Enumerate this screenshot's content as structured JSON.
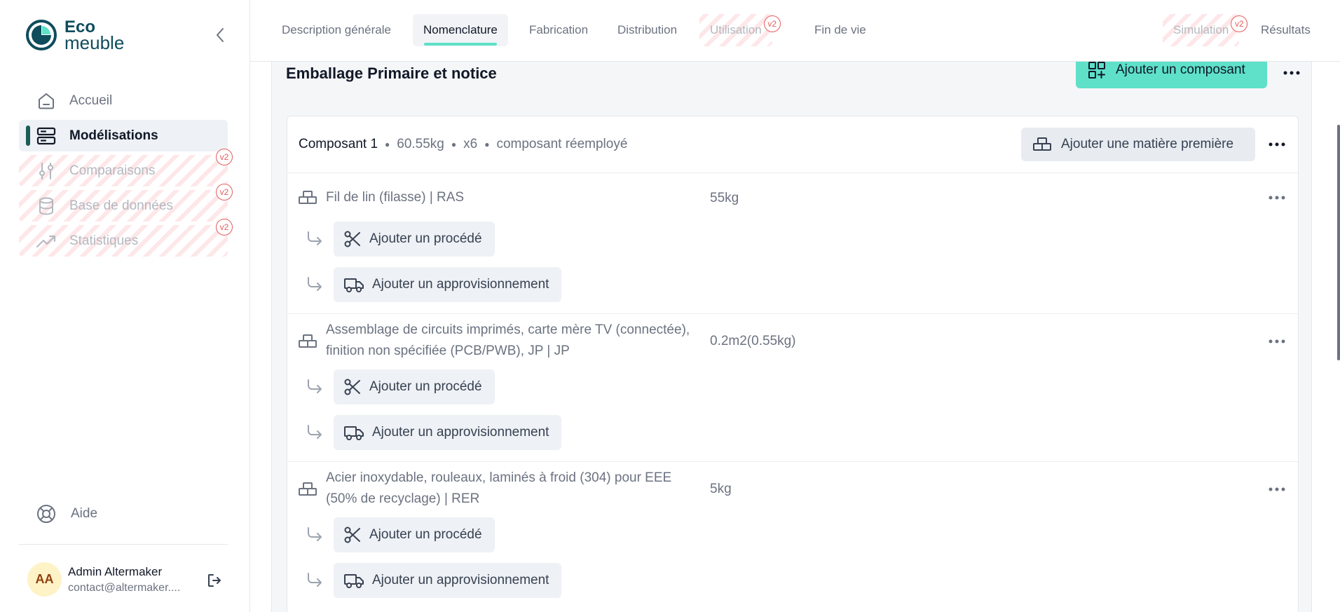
{
  "app": {
    "logo_line1": "Eco",
    "logo_line2": "meuble",
    "brand_color": "#0f4c5c",
    "accent_color": "#5ee1c8"
  },
  "sidebar": {
    "items": [
      {
        "label": "Accueil",
        "icon": "home-icon",
        "state": "normal"
      },
      {
        "label": "Modélisations",
        "icon": "server-icon",
        "state": "active"
      },
      {
        "label": "Comparaisons",
        "icon": "sliders-icon",
        "state": "disabled",
        "badge": "v2"
      },
      {
        "label": "Base de données",
        "icon": "database-icon",
        "state": "disabled",
        "badge": "v2"
      },
      {
        "label": "Statistiques",
        "icon": "trending-up-icon",
        "state": "disabled",
        "badge": "v2"
      }
    ],
    "help_label": "Aide",
    "user": {
      "initials": "AA",
      "name": "Admin Altermaker",
      "email": "contact@altermaker...."
    }
  },
  "tabs": [
    {
      "label": "Description générale",
      "state": "normal"
    },
    {
      "label": "Nomenclature",
      "state": "active"
    },
    {
      "label": "Fabrication",
      "state": "normal"
    },
    {
      "label": "Distribution",
      "state": "normal"
    },
    {
      "label": "Utilisation",
      "state": "disabled",
      "badge": "v2"
    },
    {
      "label": "Fin de vie",
      "state": "normal"
    },
    {
      "label": "Simulation",
      "state": "disabled",
      "badge": "v2"
    },
    {
      "label": "Résultats",
      "state": "normal"
    }
  ],
  "section": {
    "title": "Emballage Primaire et notice",
    "add_component_label": "Ajouter un composant"
  },
  "component": {
    "name": "Composant 1",
    "weight": "60.55kg",
    "count": "x6",
    "status": "composant réemployé",
    "add_material_label": "Ajouter une matière première"
  },
  "materials": [
    {
      "name": "Fil de lin (filasse) | RAS",
      "quantity": "55kg"
    },
    {
      "name": "Assemblage de circuits imprimés, carte mère TV (connectée), finition non spécifiée (PCB/PWB), JP | JP",
      "quantity": "0.2m2(0.55kg)"
    },
    {
      "name": "Acier inoxydable, rouleaux, laminés à froid (304) pour EEE (50% de recyclage) | RER",
      "quantity": "5kg"
    }
  ],
  "actions": {
    "add_process": "Ajouter un procédé",
    "add_supply": "Ajouter un approvisionnement"
  }
}
